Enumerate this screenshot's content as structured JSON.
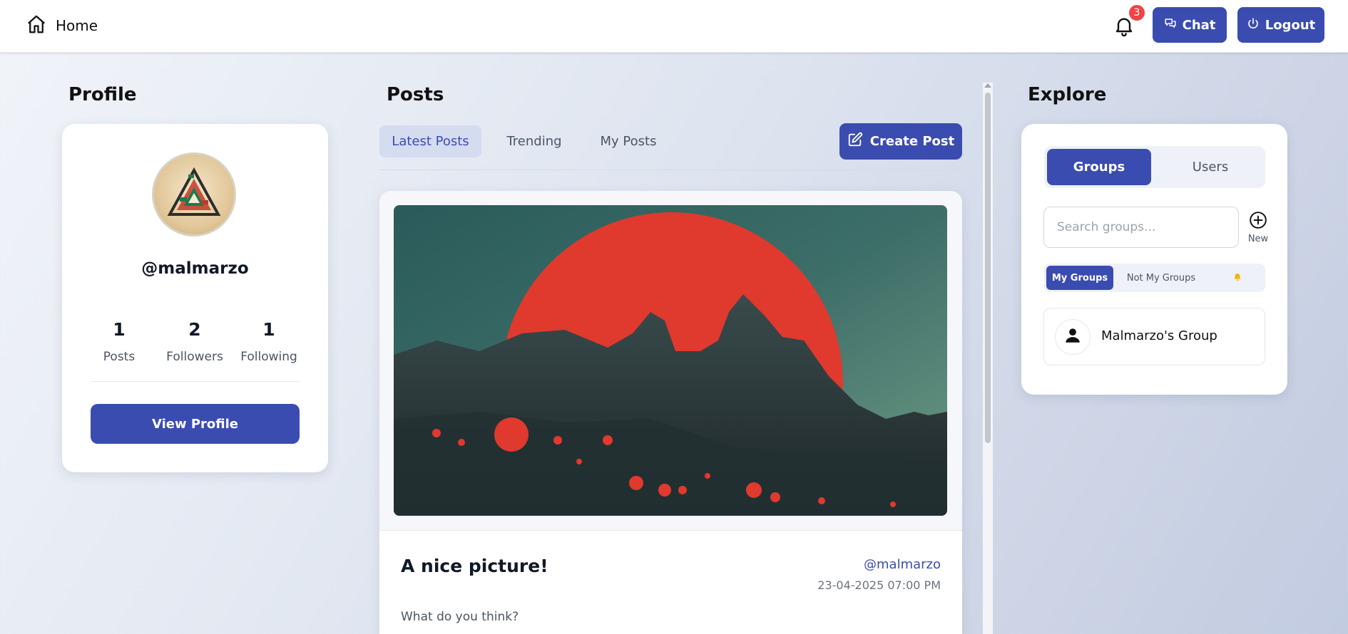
{
  "topbar": {
    "home_label": "Home",
    "notification_count": "3",
    "chat_label": "Chat",
    "logout_label": "Logout"
  },
  "profile": {
    "section_title": "Profile",
    "username": "@malmarzo",
    "stats": [
      {
        "value": "1",
        "label": "Posts"
      },
      {
        "value": "2",
        "label": "Followers"
      },
      {
        "value": "1",
        "label": "Following"
      }
    ],
    "view_profile_label": "View Profile"
  },
  "posts": {
    "section_title": "Posts",
    "tabs": [
      {
        "label": "Latest Posts",
        "active": true
      },
      {
        "label": "Trending",
        "active": false
      },
      {
        "label": "My Posts",
        "active": false
      }
    ],
    "create_post_label": "Create Post",
    "items": [
      {
        "title": "A nice picture!",
        "author": "@malmarzo",
        "date": "23-04-2025 07:00 PM",
        "body": "What do you think?"
      }
    ]
  },
  "explore": {
    "section_title": "Explore",
    "segments": [
      {
        "label": "Groups",
        "active": true
      },
      {
        "label": "Users",
        "active": false
      }
    ],
    "search_placeholder": "Search groups...",
    "new_label": "New",
    "filters": [
      {
        "label": "My Groups",
        "active": true
      },
      {
        "label": "Not My Groups",
        "active": false
      }
    ],
    "groups": [
      {
        "name": "Malmarzo's Group"
      }
    ]
  },
  "colors": {
    "accent": "#3b4cb0",
    "badge": "#ef4444",
    "notification_bell_filter": "#f5b400"
  }
}
